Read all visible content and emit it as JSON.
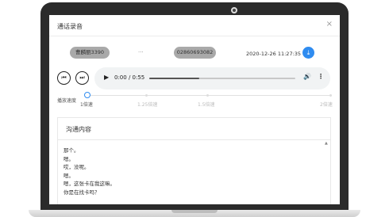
{
  "dialog": {
    "title": "通话录音",
    "close": "×"
  },
  "call": {
    "caller": "曹麟丽3390",
    "connector": "...",
    "callee": "02860693082",
    "datetime": "2020-12-26 11:27:35",
    "download_icon": "download-icon"
  },
  "player": {
    "prev_icon": "skip-previous-icon",
    "next_icon": "skip-next-icon",
    "play_icon": "play-icon",
    "time": "0:00 / 0:55",
    "progress_fraction": 0.34,
    "volume_icon": "volume-icon",
    "menu_icon": "more-vert-icon"
  },
  "speed": {
    "label": "播放速度",
    "options": [
      "1倍速",
      "1.25倍速",
      "1.5倍速",
      "2倍速"
    ],
    "selected": "1倍速"
  },
  "content": {
    "title": "沟通内容",
    "lines": [
      "那个。",
      "嗯。",
      "哎，没呢。",
      "嗯。",
      "嗯，这张卡在我这嘛。",
      "你是在找卡吗？"
    ]
  },
  "colors": {
    "accent": "#2f8cf0",
    "pill_bg": "#a9a9a9",
    "frame": "#2b2b2b"
  }
}
